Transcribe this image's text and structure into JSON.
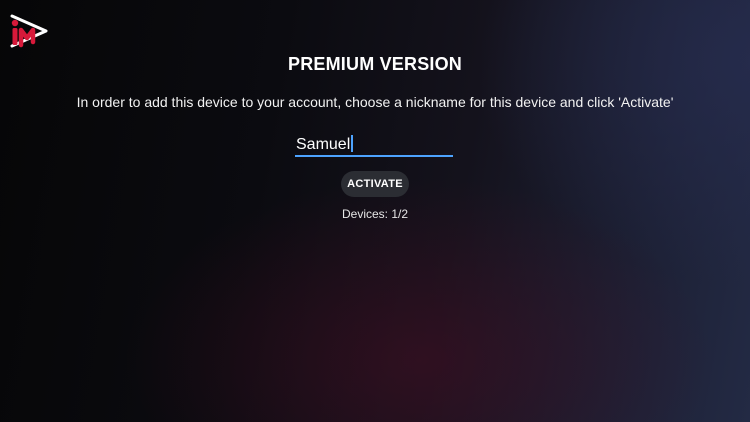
{
  "logo": {
    "icon": "app-logo-icon",
    "colors": {
      "primary": "#d7193a",
      "secondary": "#ffffff"
    }
  },
  "screen": {
    "title": "PREMIUM VERSION",
    "instructions": "In order to add this device to your account, choose a nickname for this device and click 'Activate'"
  },
  "nickname": {
    "value": "Samuel",
    "accent_color": "#4da3ff"
  },
  "activate_button": {
    "label": "ACTIVATE"
  },
  "devices": {
    "text": "Devices: 1/2"
  }
}
